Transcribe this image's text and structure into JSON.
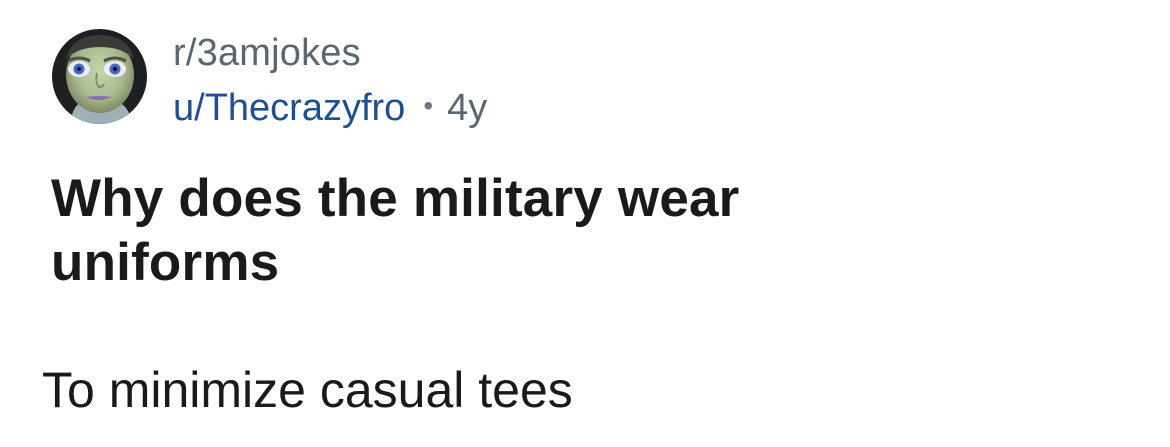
{
  "post": {
    "subreddit": "r/3amjokes",
    "author": "u/Thecrazyfro",
    "separator": "•",
    "age": "4y",
    "title": "Why does the military wear uniforms",
    "body": "To minimize casual tees"
  },
  "avatar": {
    "icon": "user-avatar-cartoon-face"
  }
}
